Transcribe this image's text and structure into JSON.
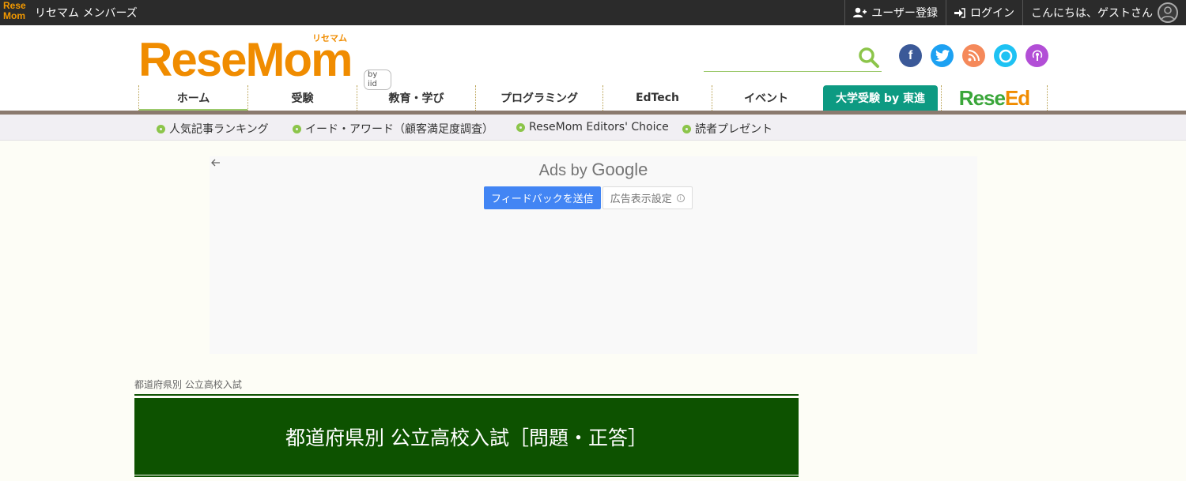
{
  "topbar": {
    "logo_text_1": "Rese",
    "logo_text_2": "Mom",
    "site_name": "リセマム メンバーズ",
    "register": "ユーザー登録",
    "login": "ログイン",
    "greeting": "こんにちは、ゲストさん"
  },
  "header": {
    "logo_main": "ReseMom",
    "logo_kana": "リセマム",
    "logo_by": "by iid",
    "search": {
      "placeholder": ""
    },
    "socials": [
      {
        "name": "facebook",
        "glyph": "f",
        "color": "#3b5998"
      },
      {
        "name": "twitter",
        "glyph": "t",
        "color": "#1da1f2"
      },
      {
        "name": "rss",
        "glyph": "))",
        "color": "#f5895a"
      },
      {
        "name": "alexa",
        "glyph": "○",
        "color": "#1ec2f3"
      },
      {
        "name": "podcast",
        "glyph": "◉",
        "color": "#b24ed6"
      }
    ]
  },
  "nav": [
    {
      "label": "ホーム"
    },
    {
      "label": "受験"
    },
    {
      "label": "教育・学び"
    },
    {
      "label": "プログラミング"
    },
    {
      "label": "EdTech"
    },
    {
      "label": "イベント"
    },
    {
      "label": "大学受験 by 東進"
    },
    {
      "label_1": "Rese",
      "label_2": "Ed"
    }
  ],
  "subnav": [
    {
      "label": "人気記事ランキング"
    },
    {
      "label": "イード・アワード（顧客満足度調査）"
    },
    {
      "label": "ReseMom Editors' Choice"
    },
    {
      "label": "読者プレゼント"
    }
  ],
  "ad": {
    "ads_by": "Ads by",
    "google": "Google",
    "feedback": "フィードバックを送信",
    "settings": "広告表示設定"
  },
  "breadcrumb": "都道府県別 公立高校入試",
  "page_title": "都道府県別 公立高校入試［問題・正答］",
  "colors": {
    "accent": "#f08c00",
    "nav_green": "#9bc96b",
    "special_tab": "#0d9a82",
    "title_bg": "#0d5200"
  }
}
